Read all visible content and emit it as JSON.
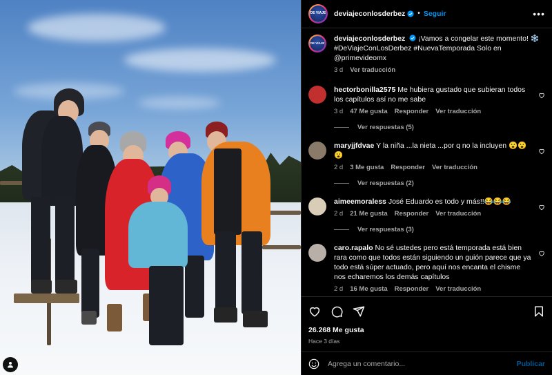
{
  "post": {
    "username": "deviajeconlosderbez",
    "follow_label": "Seguir",
    "more_label": "•••",
    "avatar_logo_text": "DE VIAJE"
  },
  "caption": {
    "username": "deviajeconlosderbez",
    "text": "¡Vamos a congelar este momento! ❄️ #DeViajeConLosDerbez #NuevaTemporada Solo en @primevideomx",
    "time": "3 d",
    "translate": "Ver traducción"
  },
  "comments": [
    {
      "username": "hectorbonilla2575",
      "text": "Me hubiera gustado que subieran todos los capítulos así no me sabe",
      "time": "3 d",
      "likes": "47 Me gusta",
      "reply": "Responder",
      "translate": "Ver traducción",
      "replies": "Ver respuestas (5)",
      "avatar_color": "#c22f2f"
    },
    {
      "username": "maryjjfdvae",
      "text": "Y la niña ...la nieta ...por q no la incluyen 😮😮😮",
      "time": "2 d",
      "likes": "3 Me gusta",
      "reply": "Responder",
      "translate": "Ver traducción",
      "replies": "Ver respuestas (2)",
      "avatar_color": "#8a7a6a"
    },
    {
      "username": "aimeemoraless",
      "text": "José Eduardo es todo y más!!😂😂😂",
      "time": "2 d",
      "likes": "21 Me gusta",
      "reply": "Responder",
      "translate": "Ver traducción",
      "replies": "Ver respuestas (3)",
      "avatar_color": "#d9cdb8"
    },
    {
      "username": "caro.rapalo",
      "text": "No sé ustedes pero está temporada está bien rara como que todos están siguiendo un guión parece que ya todo está súper actuado, pero aquí nos encanta el chisme nos echaremos los demás capítulos",
      "time": "2 d",
      "likes": "16 Me gusta",
      "reply": "Responder",
      "translate": "Ver traducción",
      "replies": "",
      "avatar_color": "#b8b0a8"
    }
  ],
  "actions": {
    "likes": "26.268 Me gusta",
    "ago": "Hace 3 días",
    "icons": [
      "heart-icon",
      "comment-icon",
      "share-icon",
      "bookmark-icon"
    ]
  },
  "add_comment": {
    "placeholder": "Agrega un comentario...",
    "post_label": "Publicar"
  },
  "colors": {
    "accent": "#0095f6",
    "background": "#000000",
    "secondary_text": "#a8a8a8"
  }
}
